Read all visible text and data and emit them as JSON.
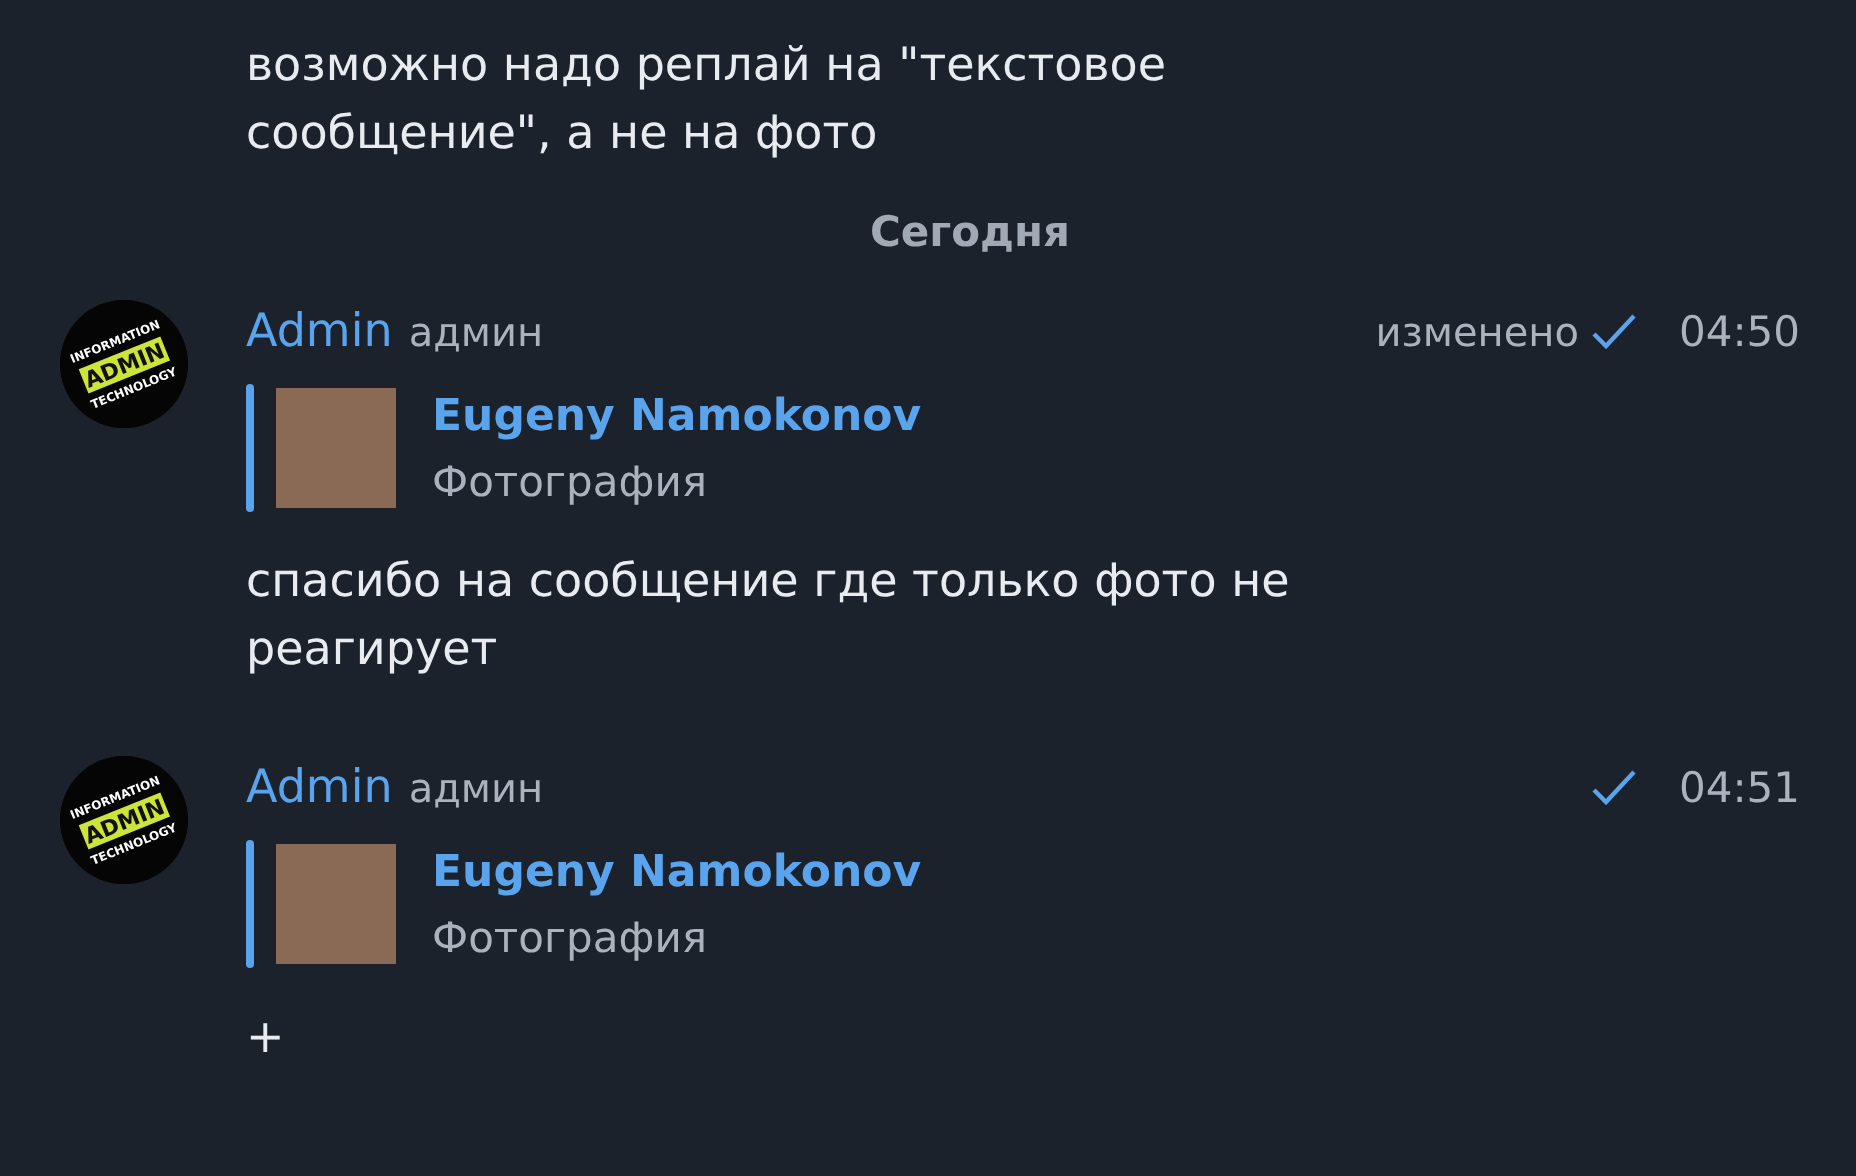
{
  "previous_message": {
    "text": "возможно надо реплай на \"текстовое сообщение\", а не на фото"
  },
  "date_separator": "Сегодня",
  "messages": [
    {
      "avatar": {
        "lines": [
          "INFORMATION",
          "ADMIN",
          "TECHNOLOGY"
        ]
      },
      "author": "Admin",
      "role": "админ",
      "edited_label": "изменено",
      "read": true,
      "time": "04:50",
      "reply": {
        "author": "Eugeny Namokonov",
        "text": "Фотография"
      },
      "text": "спасибо на сообщение где только фото не реагирует"
    },
    {
      "avatar": {
        "lines": [
          "INFORMATION",
          "ADMIN",
          "TECHNOLOGY"
        ]
      },
      "author": "Admin",
      "role": "админ",
      "read": true,
      "time": "04:51",
      "reply": {
        "author": "Eugeny Namokonov",
        "text": "Фотография"
      },
      "text": "+"
    }
  ]
}
